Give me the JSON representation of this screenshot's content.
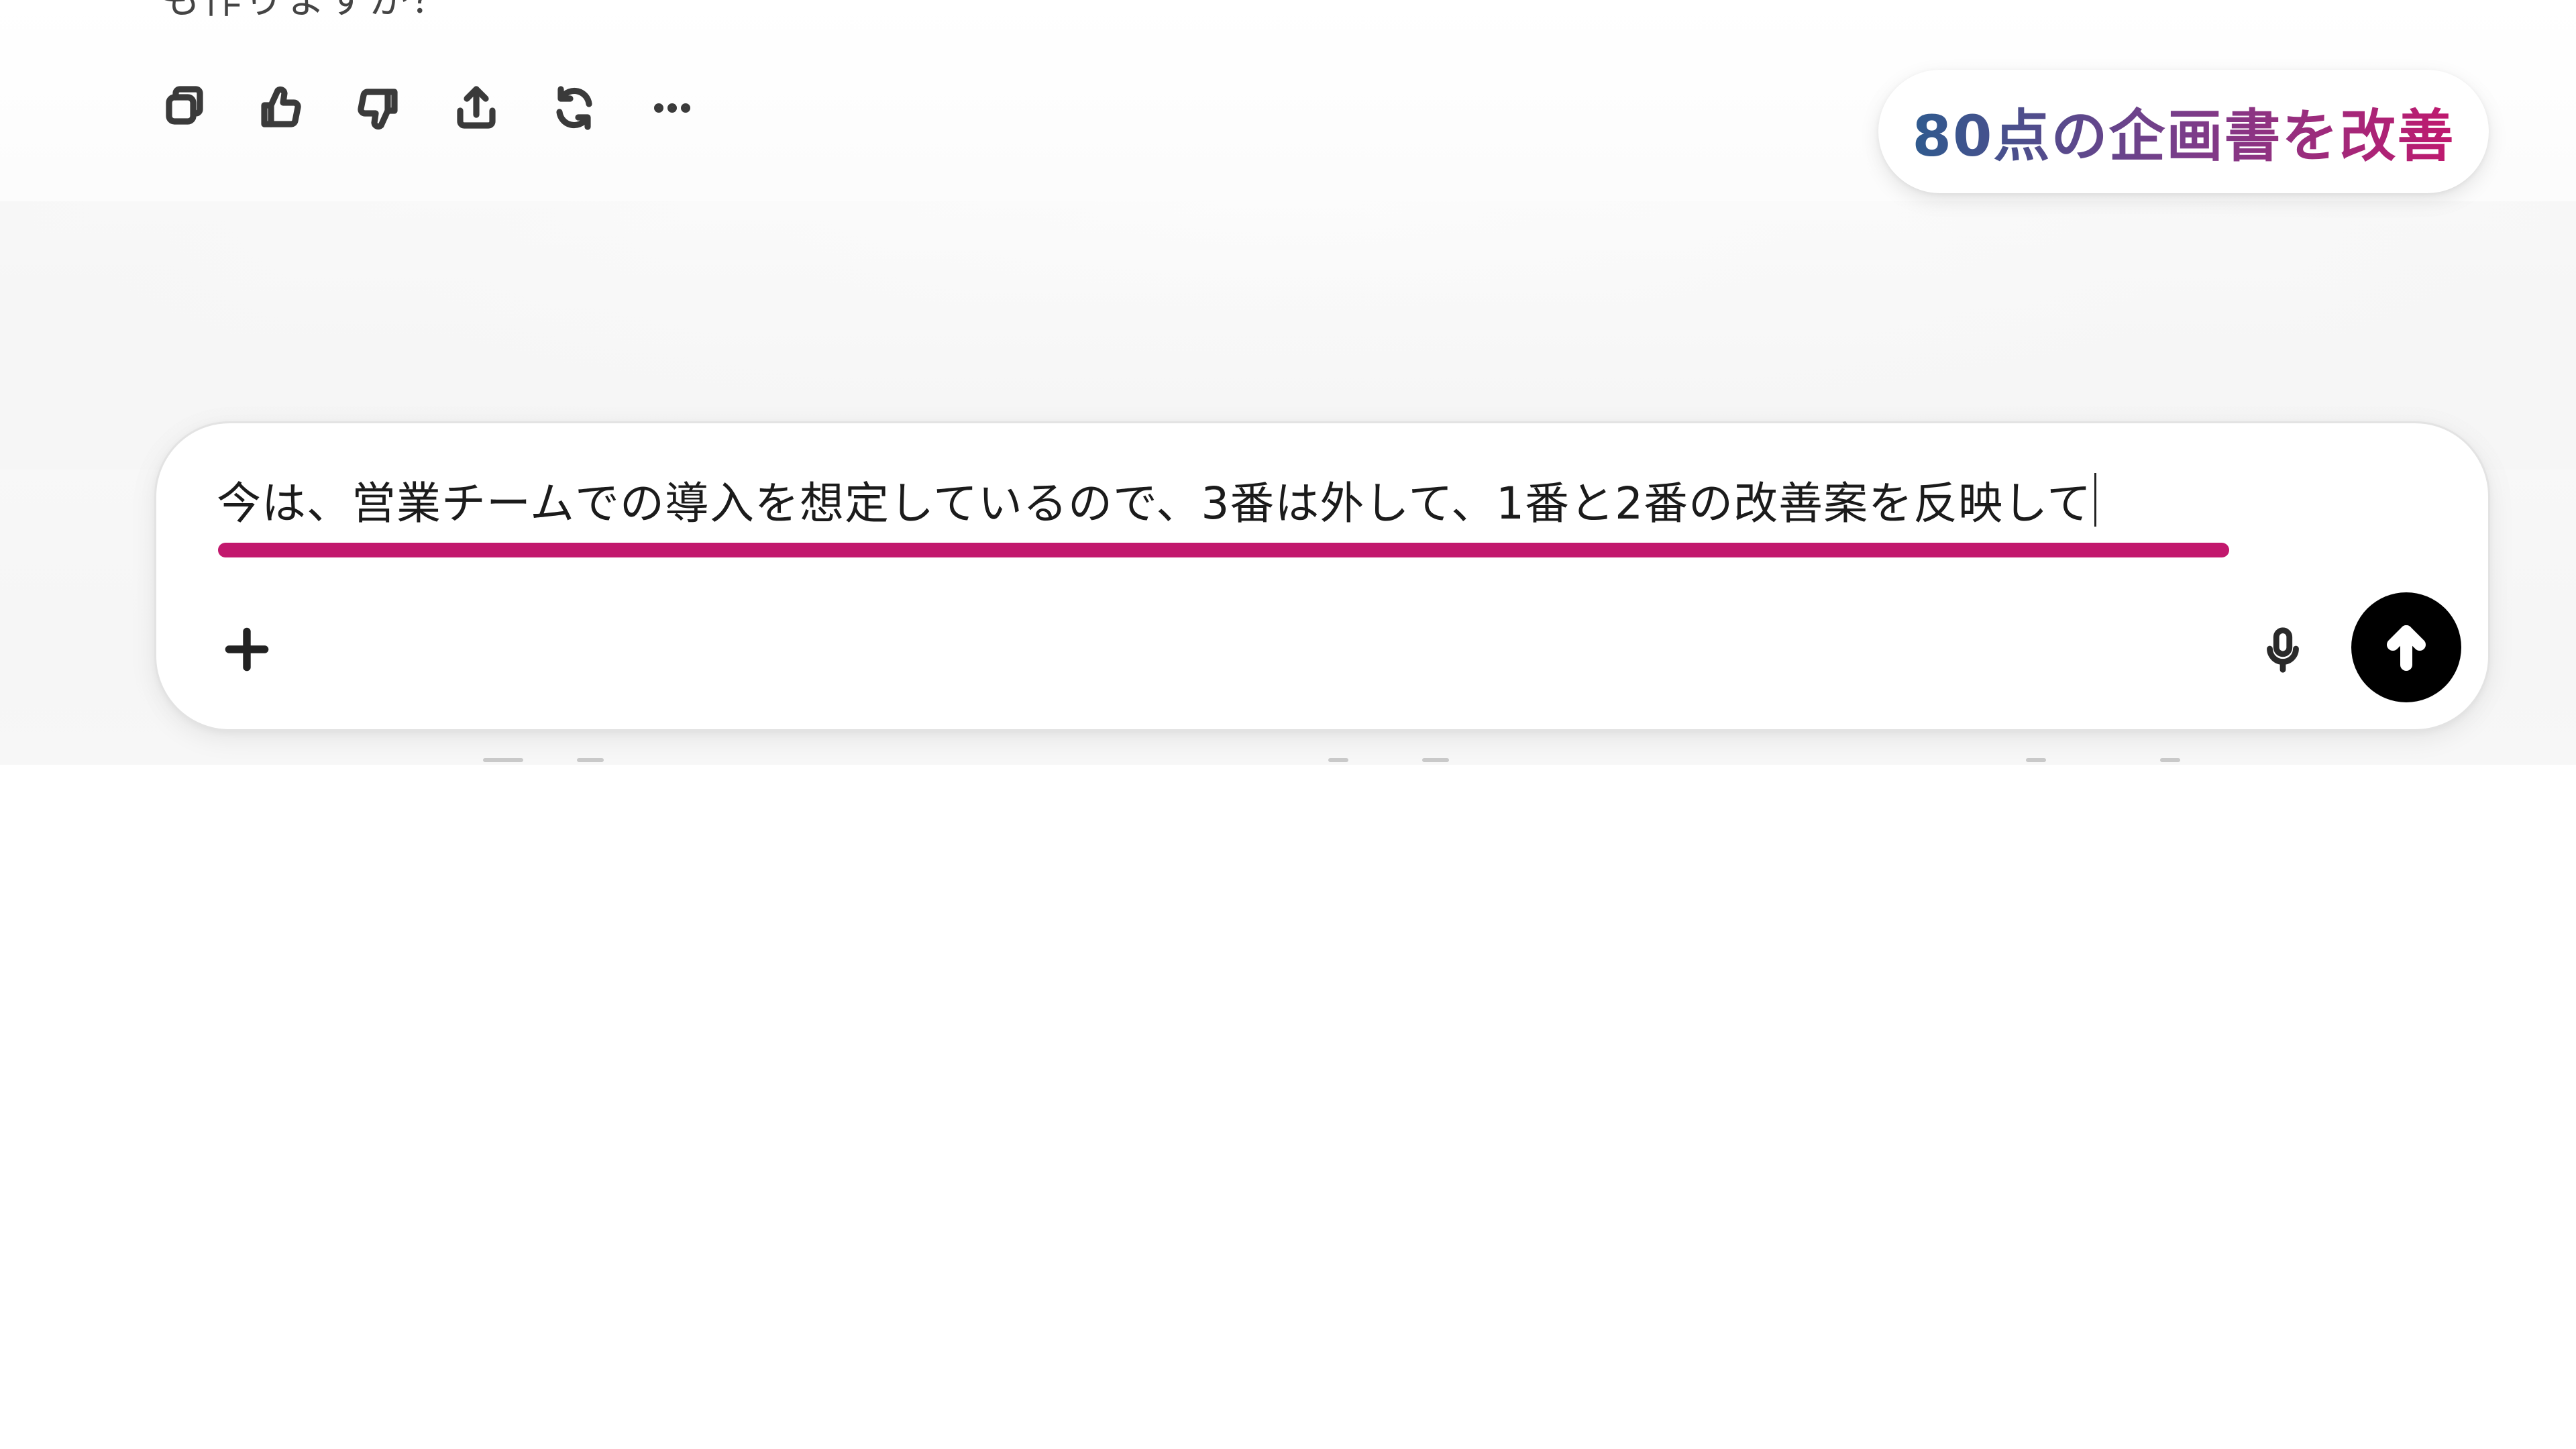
{
  "conversation": {
    "cutoff_text": "も作りますか？"
  },
  "message_actions": [
    {
      "name": "copy",
      "icon": "copy-icon"
    },
    {
      "name": "thumbs-up",
      "icon": "thumbs-up-icon"
    },
    {
      "name": "thumbs-down",
      "icon": "thumbs-down-icon"
    },
    {
      "name": "share",
      "icon": "share-icon"
    },
    {
      "name": "regenerate",
      "icon": "regenerate-icon"
    },
    {
      "name": "more",
      "icon": "more-icon"
    }
  ],
  "badge": {
    "text": "80点の企画書を改善",
    "gradient_colors": [
      "#2f5a8e",
      "#7a3d8a",
      "#c0196e"
    ]
  },
  "composer": {
    "input_value": "今は、営業チームでの導入を想定しているので、3番は外して、1番と2番の改善案を反映して",
    "underline_color": "#c2186d",
    "attach_icon": "plus-icon",
    "voice_icon": "microphone-icon",
    "send_icon": "arrow-up-icon"
  }
}
